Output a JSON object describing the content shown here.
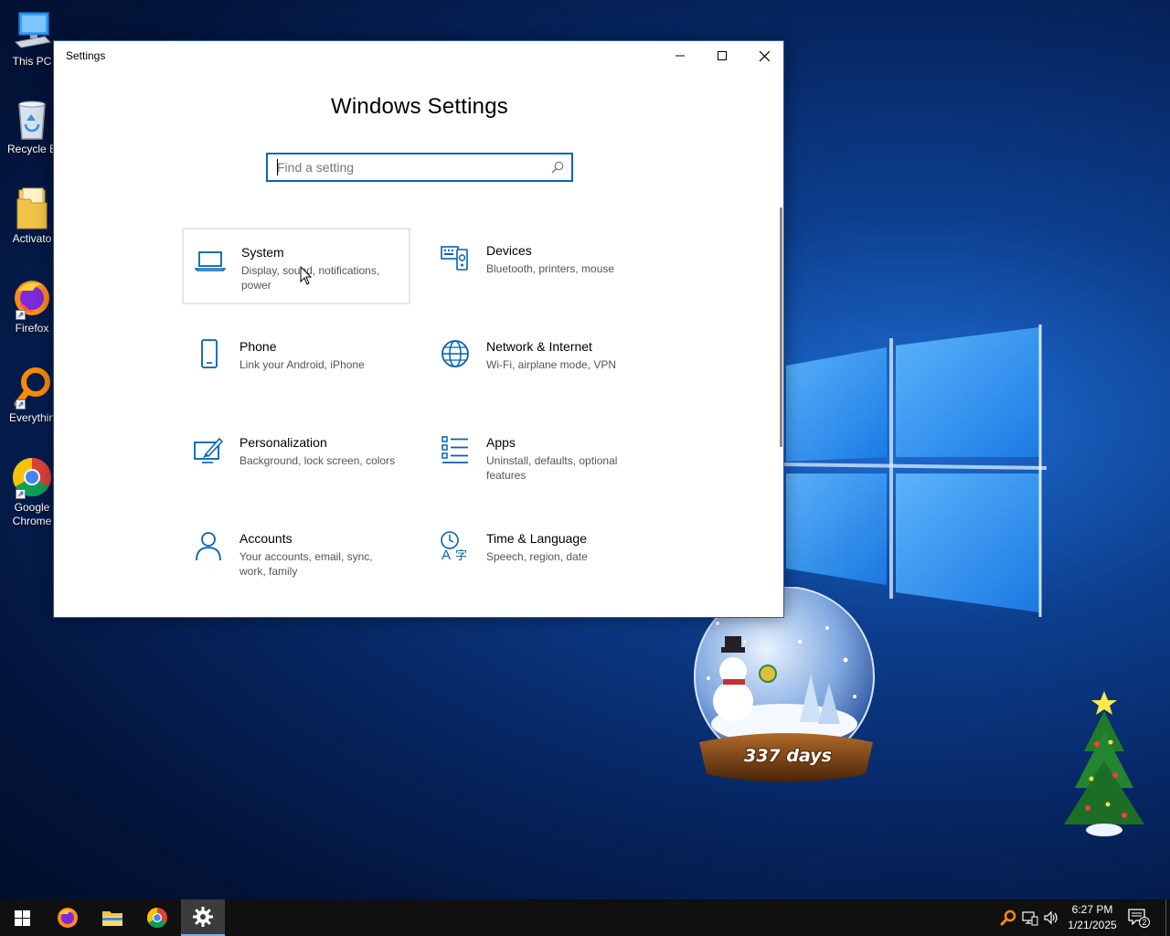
{
  "desktop": {
    "icons": [
      {
        "label": "This PC",
        "icon": "this-pc-icon"
      },
      {
        "label": "Recycle B",
        "icon": "recycle-bin-icon"
      },
      {
        "label": "Activato",
        "icon": "folder-icon"
      },
      {
        "label": "Firefox",
        "icon": "firefox-icon"
      },
      {
        "label": "Everythin",
        "icon": "everything-search-icon"
      },
      {
        "label": "Google\nChrome",
        "icon": "chrome-icon"
      }
    ],
    "globe_caption": "337 days"
  },
  "window": {
    "title": "Settings",
    "heading": "Windows Settings",
    "search_placeholder": "Find a setting",
    "tiles": [
      {
        "name": "System",
        "desc": "Display, sound, notifications, power",
        "icon": "laptop-icon"
      },
      {
        "name": "Devices",
        "desc": "Bluetooth, printers, mouse",
        "icon": "devices-icon"
      },
      {
        "name": "Phone",
        "desc": "Link your Android, iPhone",
        "icon": "phone-icon"
      },
      {
        "name": "Network & Internet",
        "desc": "Wi-Fi, airplane mode, VPN",
        "icon": "globe-icon"
      },
      {
        "name": "Personalization",
        "desc": "Background, lock screen, colors",
        "icon": "personalization-icon"
      },
      {
        "name": "Apps",
        "desc": "Uninstall, defaults, optional features",
        "icon": "apps-list-icon"
      },
      {
        "name": "Accounts",
        "desc": "Your accounts, email, sync, work, family",
        "icon": "person-icon"
      },
      {
        "name": "Time & Language",
        "desc": "Speech, region, date",
        "icon": "time-language-icon"
      }
    ]
  },
  "taskbar": {
    "pinned": [
      "start-icon",
      "firefox-icon",
      "file-explorer-icon",
      "chrome-icon",
      "settings-gear-icon"
    ],
    "time": "6:27 PM",
    "date": "1/21/2025",
    "notification_count": "2"
  },
  "colors": {
    "accent": "#0a64b8",
    "icon_blue": "#0063b1"
  }
}
